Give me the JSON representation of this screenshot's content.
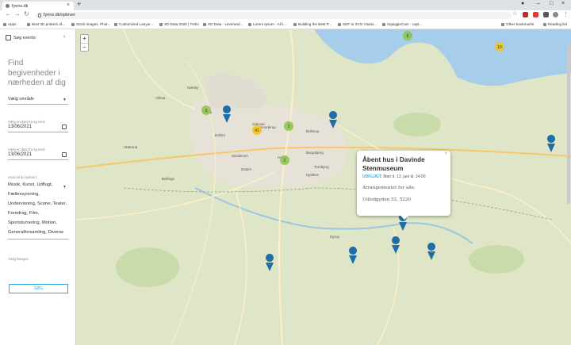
{
  "browser": {
    "tab_title": "fyens.dk",
    "url": "fyens.dk/oplever",
    "bookmarks": [
      "Apps",
      "Best 3D printers of...",
      "Stock images, Phot...",
      "Customized Lanyar...",
      "XD Data 2020 | Trello",
      "XD Data - Leverand...",
      "Lorem Ipsum - All t...",
      "Building the Best P...",
      "SDF to SVG rotatio...",
      "SquiggleCam - capt..."
    ],
    "other_bookmarks": "Other bookmarks",
    "reading_list": "Reading list"
  },
  "sidebar": {
    "header": "Søg events",
    "heading": "Find begivenheder i nærheden af dig",
    "area_placeholder": "Vælg område",
    "from_label": "Vælg en dato fra og med:",
    "from_date": "13/06/2021",
    "to_label": "Vælg en dato fra og med:",
    "to_date": "13/06/2021",
    "category_label": "Hvad vil du opleve?",
    "categories": "Musik, Kunst, Udflugt, Fællessyisning, Undervisning, Scene, Teater, Foredrag, Film, Sportsturnering, Motion, Generalforsamling, Diverse",
    "category_hint": "Vælg kategori",
    "search_button": "SØG"
  },
  "map": {
    "zoom_in": "+",
    "zoom_out": "−",
    "places": [
      "Odense",
      "Bolbro",
      "Dalum",
      "Hunderup",
      "Bellinge",
      "Tarup",
      "Bullerup",
      "Bergsbjerg",
      "Fraugde",
      "Tornbjerg",
      "Hjallese",
      "Højby",
      "Sanderum",
      "Dyrup",
      "Næsby",
      "Ubberud",
      "Allesø"
    ],
    "clusters": [
      "6",
      "10",
      "3",
      "2",
      "41",
      "2"
    ],
    "popup": {
      "title": "Åbent hus i Davinde Stenmuseum",
      "category": "UDFLUGT:",
      "datetime": "Man d. 13. juni kl. 14:00",
      "description": "Arrangementet for alle.",
      "address": "Udlodgyden 52, 5220",
      "close": "×"
    }
  }
}
